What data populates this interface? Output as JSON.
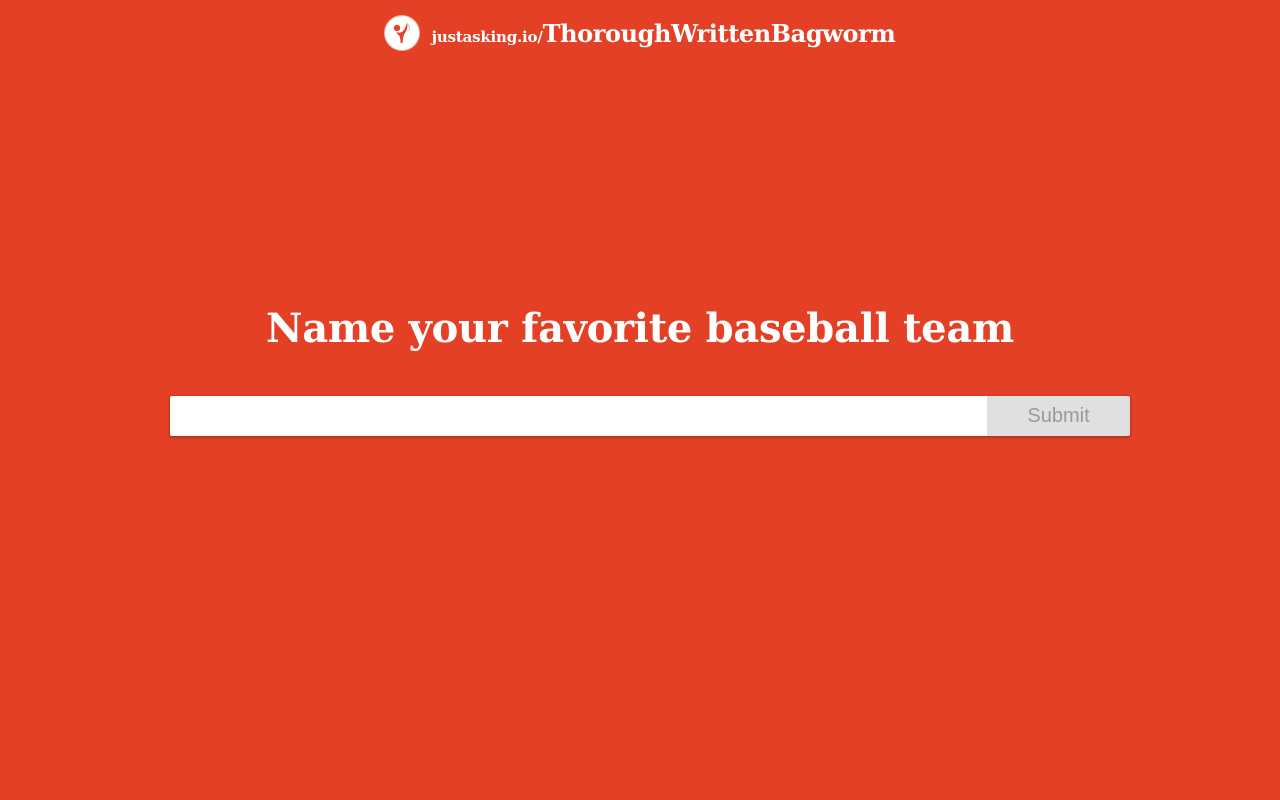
{
  "header": {
    "logo_icon": "justasking-person-logo-icon",
    "domain": "justasking.io/",
    "slug": "ThoroughWrittenBagworm"
  },
  "question": {
    "text": "Name your favorite baseball team"
  },
  "answer_form": {
    "input_value": "",
    "input_placeholder": "",
    "submit_label": "Submit"
  },
  "colors": {
    "background": "#e34026",
    "text": "#ffffff",
    "input_background": "#ffffff",
    "submit_background": "#e0e0e0",
    "submit_text": "#9a9a9a"
  }
}
